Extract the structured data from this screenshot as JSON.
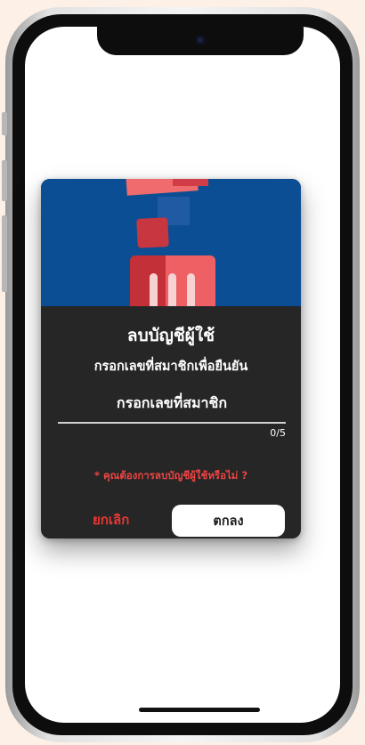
{
  "dialog": {
    "title": "ลบบัญชีผู้ใช้",
    "subtitle": "กรอกเลขที่สมาชิกเพื่อยืนยัน",
    "input_placeholder": "กรอกเลขที่สมาชิก",
    "input_value": "",
    "char_counter": "0/5",
    "warning": "* คุณต้องการลบบัญชีผู้ใช้หรือไม่ ?",
    "cancel_label": "ยกเลิก",
    "confirm_label": "ตกลง"
  },
  "colors": {
    "page_background": "#fdf0e6",
    "hero_blue": "#0c4e93",
    "dialog_background": "#262626",
    "warning_red": "#ef4444",
    "cancel_red": "#e53935",
    "confirm_button": "#ffffff"
  },
  "icons": {
    "hero": "trash-bin-illustration"
  }
}
